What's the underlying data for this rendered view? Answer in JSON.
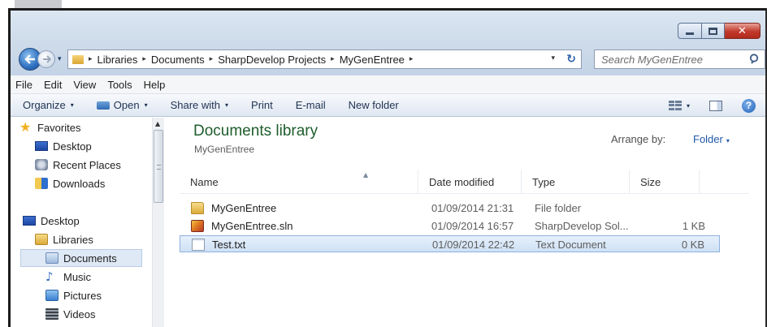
{
  "window": {
    "minimize_label": "",
    "maximize_label": "",
    "close_glyph": "✕"
  },
  "address": {
    "breadcrumbs": [
      "Libraries",
      "Documents",
      "SharpDevelop Projects",
      "MyGenEntree"
    ],
    "separator": "▸",
    "dropdown_glyph": "▾",
    "refresh_glyph": "↻"
  },
  "search": {
    "placeholder": "Search MyGenEntree"
  },
  "menu": [
    "File",
    "Edit",
    "View",
    "Tools",
    "Help"
  ],
  "toolbar": {
    "organize": "Organize",
    "open": "Open",
    "share_with": "Share with",
    "print": "Print",
    "email": "E-mail",
    "new_folder": "New folder",
    "caret": "▾",
    "help": "?"
  },
  "nav": {
    "favorites": "Favorites",
    "desktop_fav": "Desktop",
    "recent_places": "Recent Places",
    "downloads": "Downloads",
    "desktop": "Desktop",
    "libraries": "Libraries",
    "documents": "Documents",
    "music": "Music",
    "pictures": "Pictures",
    "videos": "Videos"
  },
  "content": {
    "title": "Documents library",
    "subtitle": "MyGenEntree",
    "arrange_label": "Arrange by:",
    "arrange_value": "Folder",
    "columns": {
      "name": "Name",
      "date": "Date modified",
      "type": "Type",
      "size": "Size"
    },
    "files": [
      {
        "name": "MyGenEntree",
        "date": "01/09/2014 21:31",
        "type": "File folder",
        "size": "",
        "icon": "folder-icon"
      },
      {
        "name": "MyGenEntree.sln",
        "date": "01/09/2014 16:57",
        "type": "SharpDevelop Sol...",
        "size": "1 KB",
        "icon": "solution-file-icon"
      },
      {
        "name": "Test.txt",
        "date": "01/09/2014 22:42",
        "type": "Text Document",
        "size": "0 KB",
        "icon": "text-file-icon"
      }
    ]
  },
  "colors": {
    "library_title": "#1e5d2c",
    "link_blue": "#1e58a8",
    "selection": "#cfe1f6",
    "close_red": "#c0392b"
  }
}
